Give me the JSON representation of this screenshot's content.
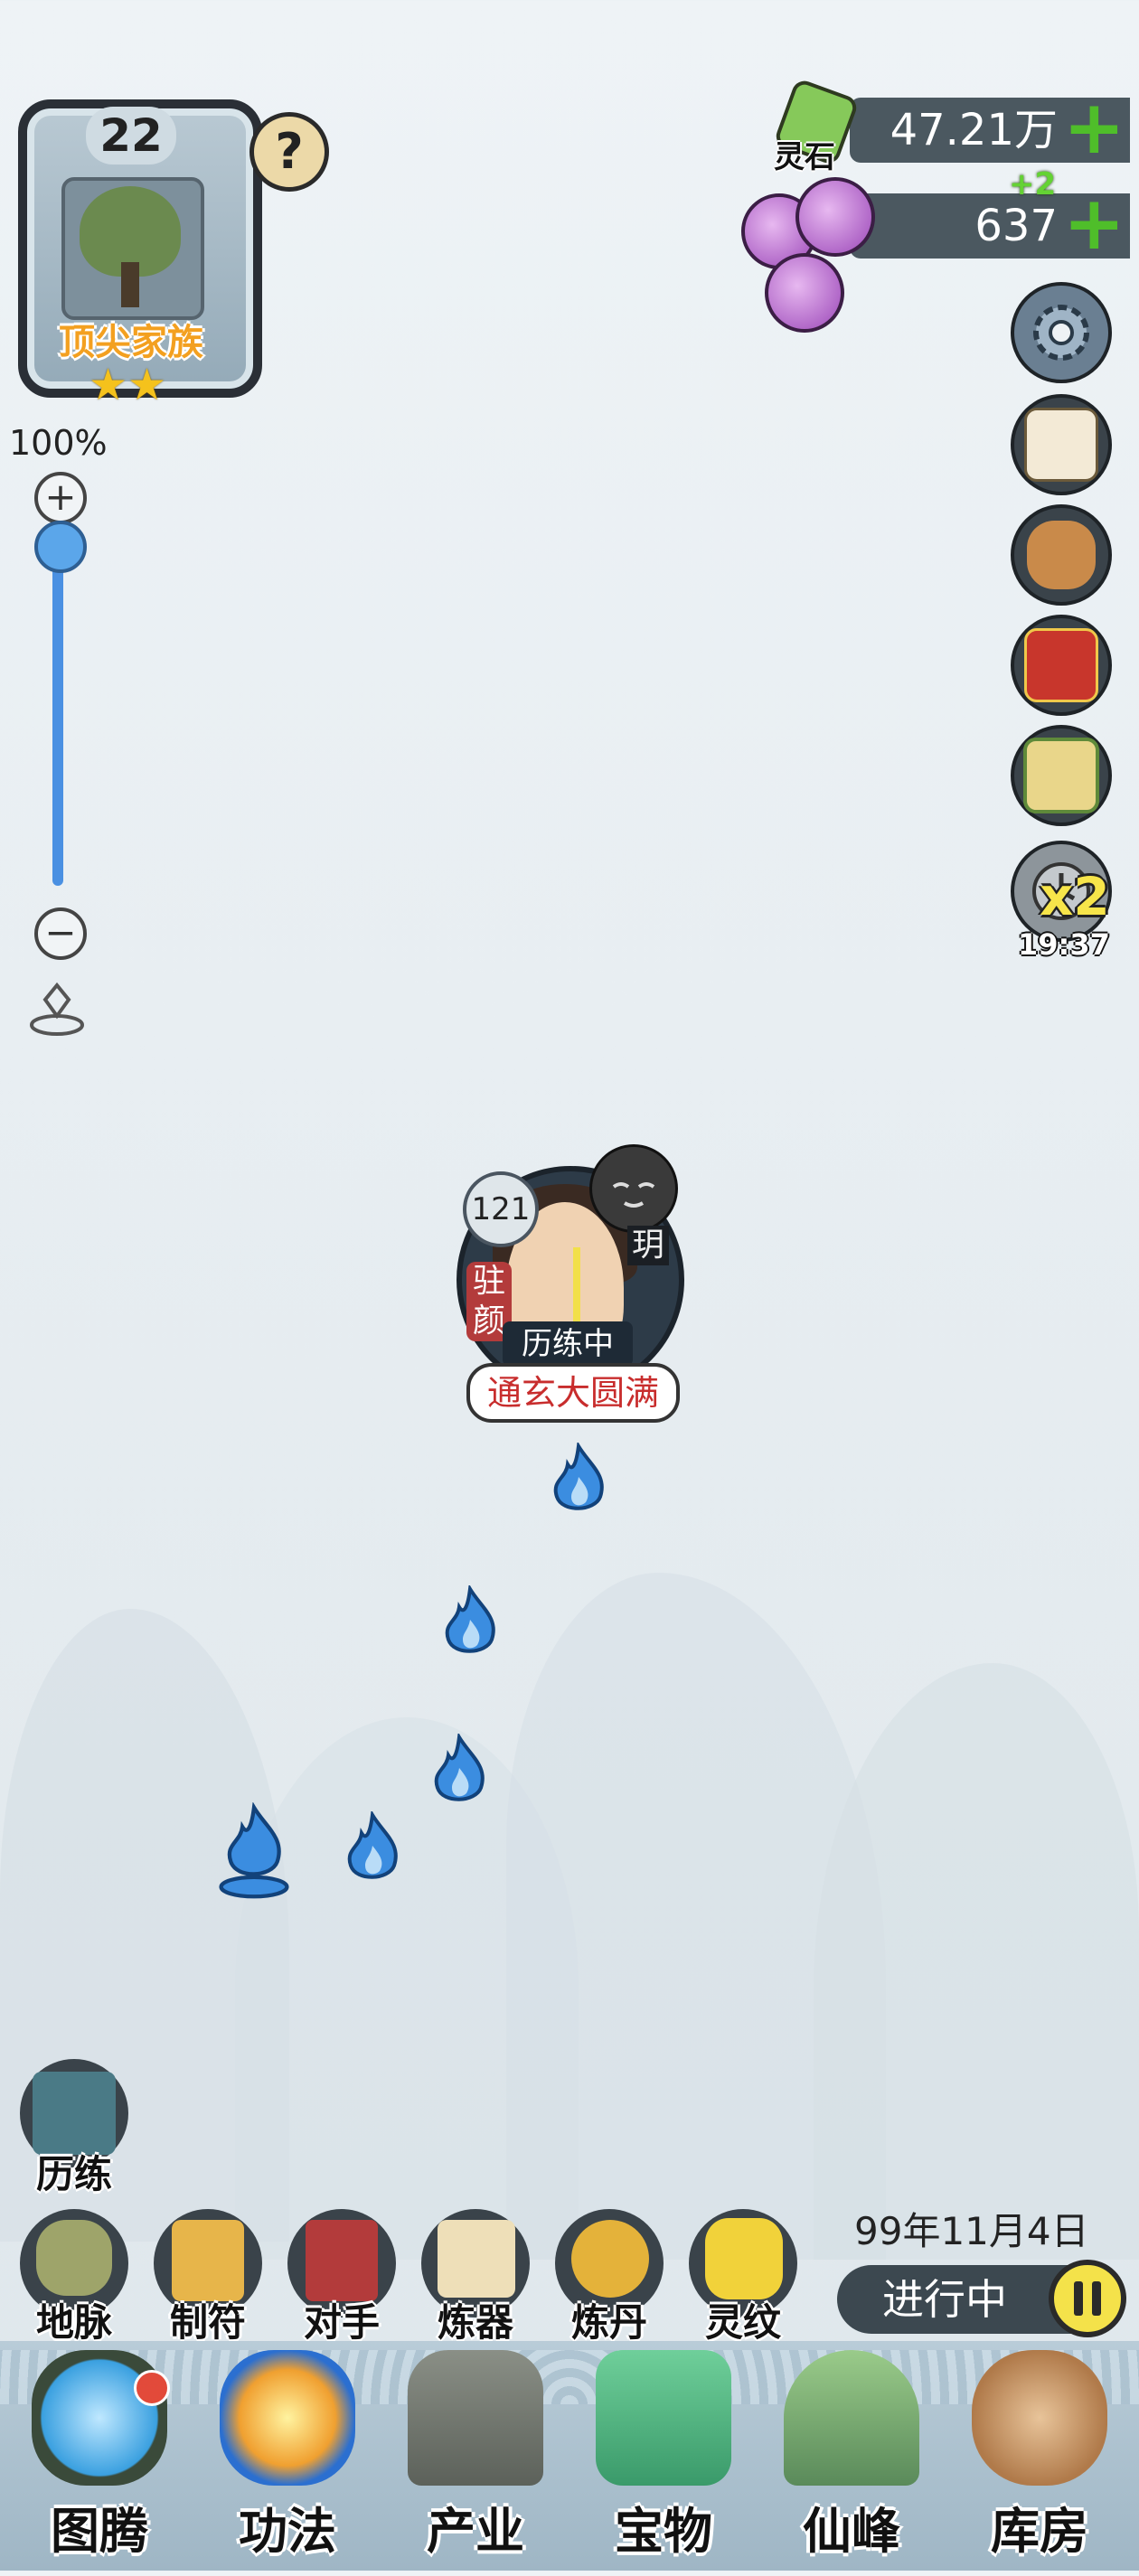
{
  "family": {
    "level": "22",
    "title": "顶尖家族",
    "stars": "★★"
  },
  "help_icon": "?",
  "zoom": {
    "percent": "100%",
    "plus": "+",
    "minus": "−"
  },
  "resources": {
    "spirit_stone_label": "灵石",
    "spirit_stone_value": "47.21万",
    "orb_value": "637",
    "orb_bonus": "+2",
    "add_symbol": "+"
  },
  "side_buttons": {
    "speed_label": "x2",
    "timer": "19:37"
  },
  "character": {
    "level": "121",
    "tag": "驻颜",
    "name_fragment": "玥",
    "status": "历练中",
    "realm": "通玄大圆满"
  },
  "actions": {
    "training": "历练",
    "items": [
      "地脉",
      "制符",
      "对手",
      "炼器",
      "炼丹",
      "灵纹"
    ]
  },
  "game_time": {
    "date": "99年11月4日",
    "status": "进行中"
  },
  "nav": [
    "图腾",
    "功法",
    "产业",
    "宝物",
    "仙峰",
    "库房"
  ],
  "colors": {
    "accent_blue": "#4a90e2",
    "plus_green": "#4fbe2a",
    "title_orange": "#f3a020",
    "realm_red": "#c82d2d"
  }
}
